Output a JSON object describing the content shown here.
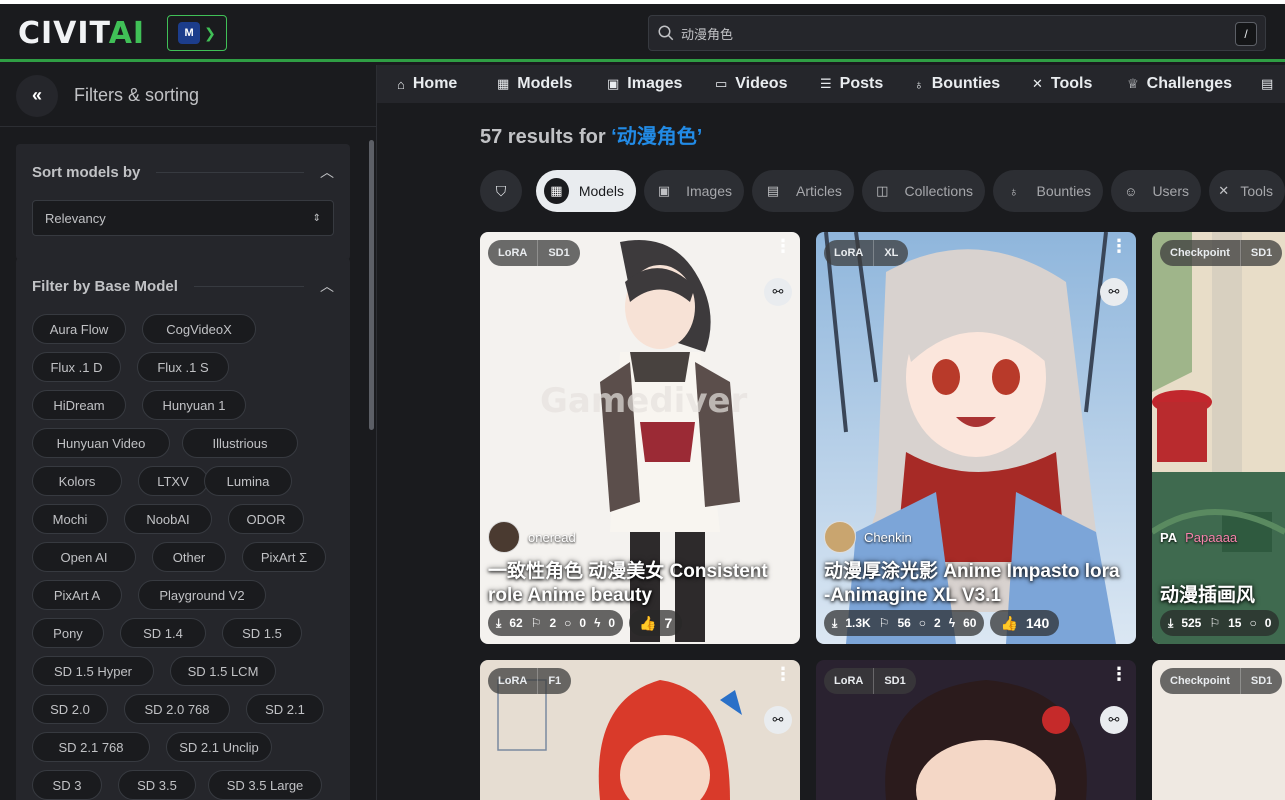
{
  "header": {
    "logo_left": "CIVIT",
    "logo_right": "AI",
    "badge_label": "M",
    "search_value": "动漫角色",
    "search_shortcut": "/"
  },
  "sidebar": {
    "title": "Filters & sorting",
    "sort_title": "Sort models by",
    "sort_value": "Relevancy",
    "base_title": "Filter by Base Model",
    "base_models": [
      "Aura Flow",
      "CogVideoX",
      "Flux .1 D",
      "Flux .1 S",
      "HiDream",
      "Hunyuan 1",
      "Hunyuan Video",
      "Illustrious",
      "Kolors",
      "LTXV",
      "Lumina",
      "Mochi",
      "NoobAI",
      "ODOR",
      "Open AI",
      "Other",
      "PixArt Σ",
      "PixArt A",
      "Playground V2",
      "Pony",
      "SD 1.4",
      "SD 1.5",
      "SD 1.5 Hyper",
      "SD 1.5 LCM",
      "SD 2.0",
      "SD 2.0 768",
      "SD 2.1",
      "SD 2.1 768",
      "SD 2.1 Unclip",
      "SD 3",
      "SD 3.5",
      "SD 3.5 Large"
    ]
  },
  "nav": [
    "Home",
    "Models",
    "Images",
    "Videos",
    "Posts",
    "Bounties",
    "Tools",
    "Challenges"
  ],
  "results": {
    "prefix": "57 results for ",
    "query": "‘动漫角色’"
  },
  "tabs": [
    "Models",
    "Images",
    "Articles",
    "Collections",
    "Bounties",
    "Users",
    "Tools"
  ],
  "cards": [
    {
      "tag1": "LoRA",
      "tag2": "SD1",
      "creator": "oneread",
      "title": "一致性角色 动漫美女 Consistent role Anime beauty",
      "downloads": "62",
      "saves": "2",
      "comments": "0",
      "buzz": "0",
      "likes": "7"
    },
    {
      "tag1": "LoRA",
      "tag2": "XL",
      "creator": "Chenkin",
      "title": "动漫厚涂光影 Anime Impasto lora -Animagine XL V3.1",
      "downloads": "1.3K",
      "saves": "56",
      "comments": "2",
      "buzz": "60",
      "likes": "140"
    },
    {
      "tag1": "Checkpoint",
      "tag2": "SD1",
      "creator": "Papaaaa",
      "creator_prefix": "PA",
      "title": "动漫插画风",
      "downloads": "525",
      "saves": "15",
      "comments": "0"
    },
    {
      "tag1": "LoRA",
      "tag2": "F1"
    },
    {
      "tag1": "LoRA",
      "tag2": "SD1"
    },
    {
      "tag1": "Checkpoint",
      "tag2": "SD1"
    }
  ],
  "colors": {
    "accent_green": "#40c057",
    "query_blue": "#228be6",
    "bg": "#1a1b1e"
  }
}
